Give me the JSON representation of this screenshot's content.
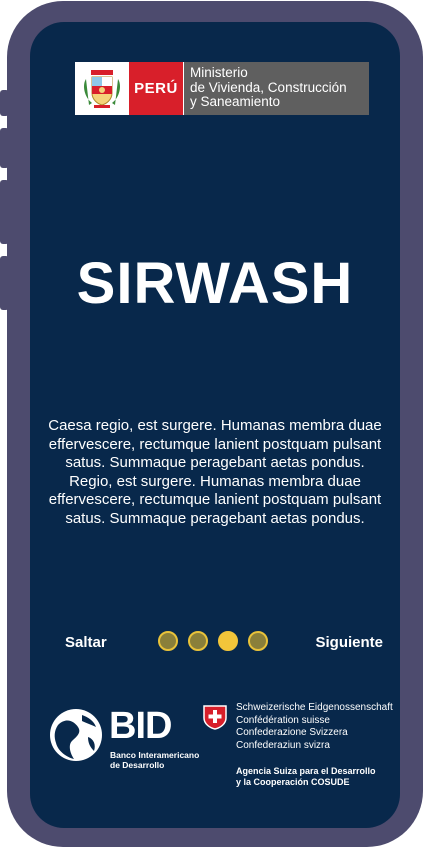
{
  "header": {
    "country": "PERÚ",
    "ministry_lines": [
      "Ministerio",
      "de Vivienda, Construcción",
      "y Saneamiento"
    ]
  },
  "title": "SIRWASH",
  "description": "Caesa regio, est surgere. Humanas membra duae effervescere, rectumque lanient postquam pulsant satus. Summaque peragebant aetas pondus. Regio, est surgere. Humanas membra duae effervescere, rectumque lanient postquam pulsant satus. Summaque peragebant aetas pondus.",
  "navigation": {
    "skip_label": "Saltar",
    "next_label": "Siguiente",
    "page_count": 4,
    "active_page": 3
  },
  "footer": {
    "bid": {
      "name": "BID",
      "subtitle_lines": [
        "Banco Interamericano",
        "de Desarrollo"
      ]
    },
    "swiss": {
      "lines": [
        "Schweizerische Eidgenossenschaft",
        "Confédération suisse",
        "Confederazione Svizzera",
        "Confederaziun svizra"
      ],
      "agency_lines": [
        "Agencia Suiza para el Desarrollo",
        "y la Cooperación COSUDE"
      ]
    }
  },
  "colors": {
    "frame": "#4d4b6e",
    "screen_bg": "#08284b",
    "peru_red": "#d81f2a",
    "ministry_gray": "#5f5f5f",
    "dot_active": "#f2c53a",
    "dot_inactive": "#8a7f3a"
  }
}
